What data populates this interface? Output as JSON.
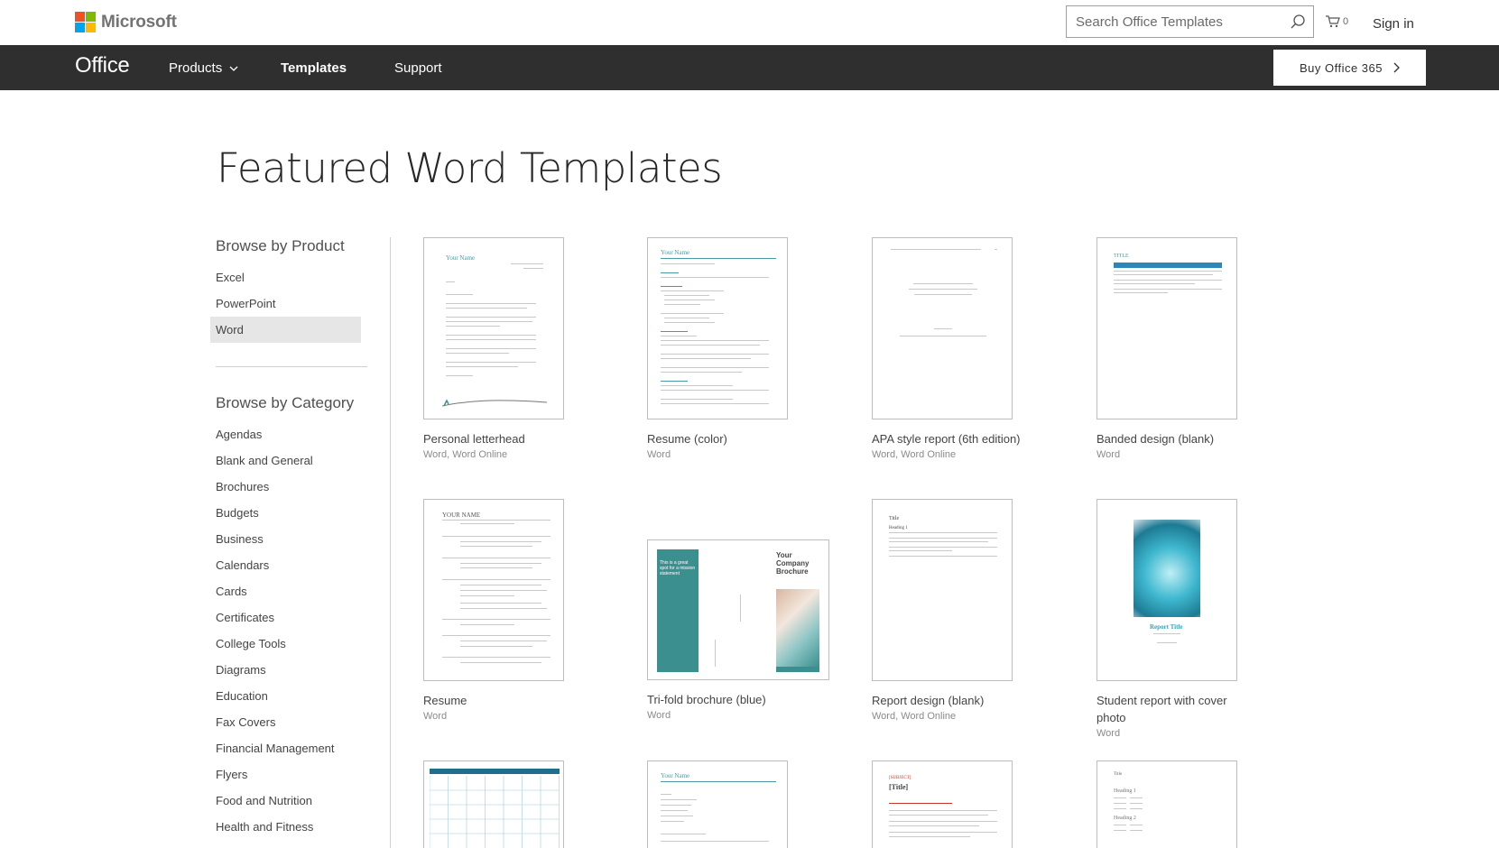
{
  "header": {
    "brand": "Microsoft",
    "search_placeholder": "Search Office Templates",
    "cart_count": "0",
    "sign_in": "Sign in",
    "logo_colors": [
      "#f25022",
      "#7fba00",
      "#00a4ef",
      "#ffb900"
    ]
  },
  "nav": {
    "office": "Office",
    "products": "Products",
    "templates": "Templates",
    "support": "Support",
    "buy": "Buy Office 365"
  },
  "page": {
    "title": "Featured Word Templates"
  },
  "sidebar": {
    "product_heading": "Browse by Product",
    "products": [
      "Excel",
      "PowerPoint",
      "Word"
    ],
    "category_heading": "Browse by Category",
    "categories": [
      "Agendas",
      "Blank and General",
      "Brochures",
      "Budgets",
      "Business",
      "Calendars",
      "Cards",
      "Certificates",
      "College Tools",
      "Diagrams",
      "Education",
      "Fax Covers",
      "Financial Management",
      "Flyers",
      "Food and Nutrition",
      "Health and Fitness"
    ]
  },
  "templates": [
    {
      "name": "Personal letterhead",
      "apps": "Word, Word Online"
    },
    {
      "name": "Resume (color)",
      "apps": "Word"
    },
    {
      "name": "APA style report (6th edition)",
      "apps": "Word, Word Online"
    },
    {
      "name": "Banded design (blank)",
      "apps": "Word"
    },
    {
      "name": "Resume",
      "apps": "Word"
    },
    {
      "name": "Tri-fold brochure (blue)",
      "apps": "Word"
    },
    {
      "name": "Report design (blank)",
      "apps": "Word, Word Online"
    },
    {
      "name": "Student report with cover photo",
      "apps": "Word"
    }
  ],
  "thumbs": {
    "letterhead_name": "Your Name",
    "resume_color_name": "Your Name",
    "banded_title": "TITLE",
    "resume_name": "YOUR NAME",
    "brochure_title": "Your Company Brochure",
    "brochure_panel": "This is a great spot for a mission statement",
    "report_title": "Title",
    "report_heading": "Heading 1",
    "student_report_title": "Report Title",
    "row3_name": "Your Name",
    "row3_title": "[Title]",
    "row3_subject": "[SUBJECT]",
    "row3_title2": "Title",
    "row3_heading1": "Heading 1",
    "row3_heading2": "Heading 2"
  },
  "colors": {
    "nav_bg": "#2f2f2f",
    "teal": "#3c8f8f",
    "active_bg": "#e6e6e6"
  }
}
